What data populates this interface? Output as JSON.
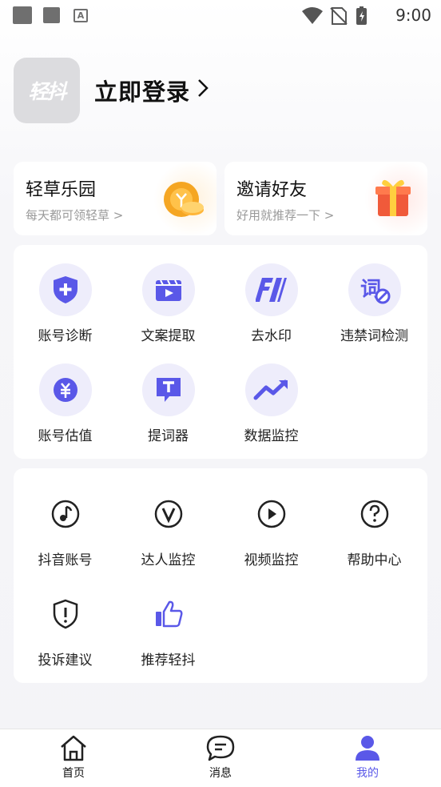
{
  "status_bar": {
    "time": "9:00"
  },
  "profile": {
    "avatar_text": "轻抖",
    "login_label": "立即登录",
    "login_chevron": ">"
  },
  "promos": [
    {
      "title": "轻草乐园",
      "subtitle": "每天都可领轻草 >"
    },
    {
      "title": "邀请好友",
      "subtitle": "好用就推荐一下 >"
    }
  ],
  "tools": [
    {
      "label": "账号诊断",
      "icon": "shield-plus-icon"
    },
    {
      "label": "文案提取",
      "icon": "video-clapper-icon"
    },
    {
      "label": "去水印",
      "icon": "remove-watermark-icon"
    },
    {
      "label": "违禁词检测",
      "icon": "forbidden-word-icon"
    },
    {
      "label": "账号估值",
      "icon": "yuan-coin-icon"
    },
    {
      "label": "提词器",
      "icon": "teleprompter-icon"
    },
    {
      "label": "数据监控",
      "icon": "trend-up-icon"
    }
  ],
  "more": [
    {
      "label": "抖音账号",
      "icon": "music-note-icon"
    },
    {
      "label": "达人监控",
      "icon": "v-badge-icon"
    },
    {
      "label": "视频监控",
      "icon": "play-circle-icon"
    },
    {
      "label": "帮助中心",
      "icon": "help-icon"
    },
    {
      "label": "投诉建议",
      "icon": "report-shield-icon"
    },
    {
      "label": "推荐轻抖",
      "icon": "thumbs-up-icon"
    }
  ],
  "bottom_nav": [
    {
      "label": "首页",
      "icon": "home-icon",
      "active": false
    },
    {
      "label": "消息",
      "icon": "message-icon",
      "active": false
    },
    {
      "label": "我的",
      "icon": "user-icon",
      "active": true
    }
  ],
  "colors": {
    "accent": "#5a58e8",
    "icon_bg": "#eeedfb",
    "coin": "#f5a623",
    "gift": "#f05a3a"
  }
}
